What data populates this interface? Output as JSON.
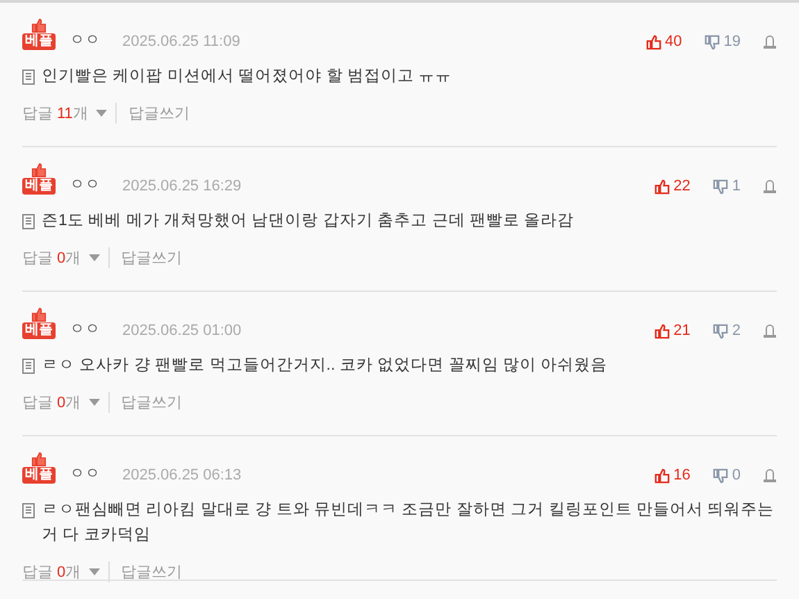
{
  "comments": [
    {
      "badge": "베플",
      "author": "ㅇㅇ",
      "date": "2025.06.25 11:09",
      "likes": "40",
      "dislikes": "19",
      "text": "인기빨은 케이팝 미션에서 떨어졌어야 할 범접이고 ㅠㅠ",
      "reply_label": "답글",
      "reply_count": "11",
      "reply_unit": "개",
      "write_reply": "답글쓰기"
    },
    {
      "badge": "베플",
      "author": "ㅇㅇ",
      "date": "2025.06.25 16:29",
      "likes": "22",
      "dislikes": "1",
      "text": "즌1도 베베 메가 개쳐망했어 남댄이랑 갑자기 춤추고 근데 팬빨로 올라감",
      "reply_label": "답글",
      "reply_count": "0",
      "reply_unit": "개",
      "write_reply": "답글쓰기"
    },
    {
      "badge": "베플",
      "author": "ㅇㅇ",
      "date": "2025.06.25 01:00",
      "likes": "21",
      "dislikes": "2",
      "text": "ㄹㅇ 오사카 걍 팬빨로 먹고들어간거지.. 코카 없었다면 꼴찌임 많이 아쉬웠음",
      "reply_label": "답글",
      "reply_count": "0",
      "reply_unit": "개",
      "write_reply": "답글쓰기"
    },
    {
      "badge": "베플",
      "author": "ㅇㅇ",
      "date": "2025.06.25 06:13",
      "likes": "16",
      "dislikes": "0",
      "text": "ㄹㅇ팬심빼면 리아킴 말대로 걍 트와 뮤빈데ㅋㅋ 조금만 잘하면 그거 킬링포인트 만들어서 띄워주는거 다 코카덕임",
      "reply_label": "답글",
      "reply_count": "0",
      "reply_unit": "개",
      "write_reply": "답글쓰기"
    }
  ]
}
